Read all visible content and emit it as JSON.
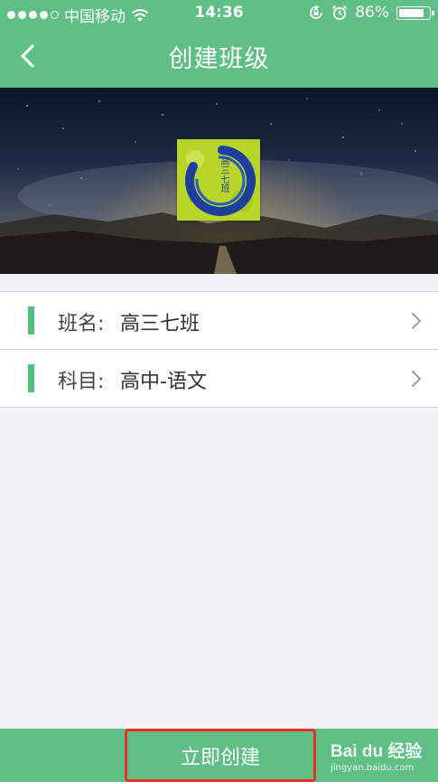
{
  "status_bar": {
    "carrier": "中国移动",
    "time": "14:36",
    "battery": "86%",
    "battery_level": 0.86,
    "icons": [
      "signal-dots-icon",
      "wifi-icon",
      "rotation-lock-icon",
      "alarm-icon",
      "battery-icon"
    ]
  },
  "nav": {
    "title": "创建班级",
    "back_icon": "chevron-left-icon"
  },
  "banner": {
    "cover_text": "高三七班"
  },
  "form": {
    "rows": [
      {
        "label": "班名:",
        "value": "高三七班",
        "icon": "chevron-right-icon"
      },
      {
        "label": "科目:",
        "value": "高中-语文",
        "icon": "chevron-right-icon"
      }
    ]
  },
  "footer": {
    "create_label": "立即创建",
    "watermark_brand": "Bai du 经验",
    "watermark_site": "jingyan.baidu.com"
  },
  "colors": {
    "primary_green": "#5fbf85",
    "accent_bar": "#4ec07a",
    "highlight_red": "#e8312a"
  }
}
